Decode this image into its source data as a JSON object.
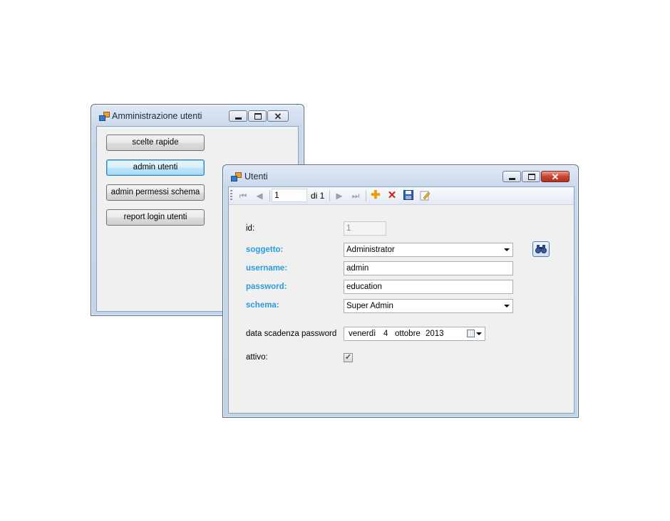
{
  "back_window": {
    "title": "Amministrazione utenti",
    "buttons": [
      {
        "label": "scelte rapide"
      },
      {
        "label": "admin utenti"
      },
      {
        "label": "admin permessi schema"
      },
      {
        "label": "report login utenti"
      }
    ]
  },
  "front_window": {
    "title": "Utenti",
    "navigator": {
      "position": "1",
      "count_label": "di 1",
      "icons": [
        "move-first-icon",
        "move-previous-icon",
        "move-next-icon",
        "move-last-icon",
        "add-new-icon",
        "delete-icon",
        "save-icon",
        "edit-icon"
      ]
    },
    "form": {
      "id_label": "id:",
      "id_value": "1",
      "soggetto_label": "soggetto:",
      "soggetto_value": "Administrator",
      "username_label": "username:",
      "username_value": "admin",
      "password_label": "password:",
      "password_value": "education",
      "schema_label": "schema:",
      "schema_value": "Super Admin",
      "scadenza_label": "data scadenza password",
      "scadenza_weekday": "venerdì",
      "scadenza_day": "4",
      "scadenza_month": "ottobre",
      "scadenza_year": "2013",
      "attivo_label": "attivo:",
      "attivo_checked": "✓"
    }
  },
  "colors": {
    "required_label": "#2a9be0",
    "close_button": "#c84530"
  }
}
